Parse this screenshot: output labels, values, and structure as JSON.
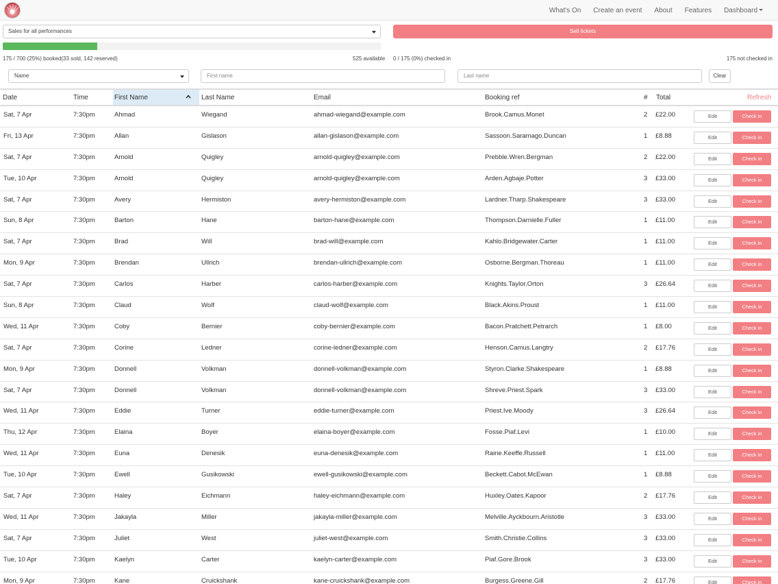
{
  "nav": {
    "links": [
      "What's On",
      "Create an event",
      "About",
      "Features",
      "Dashboard"
    ]
  },
  "performance_select": {
    "value": "Sales for all performances"
  },
  "sell_button": "Sell tickets",
  "progress": {
    "fraction": 0.25
  },
  "stats": {
    "booked": "175 / 700 (25%) booked(33 sold, 142 reserved)",
    "available": "525 available",
    "checked_in": "0 / 175 (0%) checked in",
    "not_checked_in": "175 not checked in"
  },
  "filters": {
    "field_select": "Name",
    "first_name_placeholder": "First name",
    "last_name_placeholder": "Last name",
    "clear": "Clear"
  },
  "table": {
    "headers": {
      "date": "Date",
      "time": "Time",
      "first": "First Name",
      "last": "Last Name",
      "email": "Email",
      "ref": "Booking ref",
      "count": "#",
      "total": "Total"
    },
    "refresh": "Refresh",
    "edit_label": "Edit",
    "checkin_label": "Check in",
    "rows": [
      {
        "date": "Sat, 7 Apr",
        "time": "7:30pm",
        "first": "Ahmad",
        "last": "Wiegand",
        "email": "ahmad-wiegand@example.com",
        "ref": "Brook.Camus.Monet",
        "count": "2",
        "total": "£22.00"
      },
      {
        "date": "Fri, 13 Apr",
        "time": "7:30pm",
        "first": "Allan",
        "last": "Gislason",
        "email": "allan-gislason@example.com",
        "ref": "Sassoon.Saramago.Duncan",
        "count": "1",
        "total": "£8.88"
      },
      {
        "date": "Sat, 7 Apr",
        "time": "7:30pm",
        "first": "Arnold",
        "last": "Quigley",
        "email": "arnold-quigley@example.com",
        "ref": "Prebble.Wren.Bergman",
        "count": "2",
        "total": "£22.00"
      },
      {
        "date": "Tue, 10 Apr",
        "time": "7:30pm",
        "first": "Arnold",
        "last": "Quigley",
        "email": "arnold-quigley@example.com",
        "ref": "Arden.Agbaje.Potter",
        "count": "3",
        "total": "£33.00"
      },
      {
        "date": "Sat, 7 Apr",
        "time": "7:30pm",
        "first": "Avery",
        "last": "Hermiston",
        "email": "avery-hermiston@example.com",
        "ref": "Lardner.Tharp.Shakespeare",
        "count": "3",
        "total": "£33.00"
      },
      {
        "date": "Sun, 8 Apr",
        "time": "7:30pm",
        "first": "Barton",
        "last": "Hane",
        "email": "barton-hane@example.com",
        "ref": "Thompson.Darnielle.Fuller",
        "count": "1",
        "total": "£11.00"
      },
      {
        "date": "Sat, 7 Apr",
        "time": "7:30pm",
        "first": "Brad",
        "last": "Will",
        "email": "brad-will@example.com",
        "ref": "Kahlo.Bridgewater.Carter",
        "count": "1",
        "total": "£11.00"
      },
      {
        "date": "Mon, 9 Apr",
        "time": "7:30pm",
        "first": "Brendan",
        "last": "Ullrich",
        "email": "brendan-ullrich@example.com",
        "ref": "Osborne.Bergman.Thoreau",
        "count": "1",
        "total": "£11.00"
      },
      {
        "date": "Sat, 7 Apr",
        "time": "7:30pm",
        "first": "Carlos",
        "last": "Harber",
        "email": "carlos-harber@example.com",
        "ref": "Knights.Taylor.Orton",
        "count": "3",
        "total": "£26.64"
      },
      {
        "date": "Sun, 8 Apr",
        "time": "7:30pm",
        "first": "Claud",
        "last": "Wolf",
        "email": "claud-wolf@example.com",
        "ref": "Black.Akins.Proust",
        "count": "1",
        "total": "£11.00"
      },
      {
        "date": "Wed, 11 Apr",
        "time": "7:30pm",
        "first": "Coby",
        "last": "Bernier",
        "email": "coby-bernier@example.com",
        "ref": "Bacon.Pratchett.Petrarch",
        "count": "1",
        "total": "£8.00"
      },
      {
        "date": "Sat, 7 Apr",
        "time": "7:30pm",
        "first": "Corine",
        "last": "Ledner",
        "email": "corine-ledner@example.com",
        "ref": "Henson.Camus.Langtry",
        "count": "2",
        "total": "£17.76"
      },
      {
        "date": "Mon, 9 Apr",
        "time": "7:30pm",
        "first": "Donnell",
        "last": "Volkman",
        "email": "donnell-volkman@example.com",
        "ref": "Styron.Clarke.Shakespeare",
        "count": "1",
        "total": "£8.88"
      },
      {
        "date": "Sat, 7 Apr",
        "time": "7:30pm",
        "first": "Donnell",
        "last": "Volkman",
        "email": "donnell-volkman@example.com",
        "ref": "Shreve.Priest.Spark",
        "count": "3",
        "total": "£33.00"
      },
      {
        "date": "Wed, 11 Apr",
        "time": "7:30pm",
        "first": "Eddie",
        "last": "Turner",
        "email": "eddie-turner@example.com",
        "ref": "Priest.Ive.Moody",
        "count": "3",
        "total": "£26.64"
      },
      {
        "date": "Thu, 12 Apr",
        "time": "7:30pm",
        "first": "Elaina",
        "last": "Boyer",
        "email": "elaina-boyer@example.com",
        "ref": "Fosse.Piaf.Levi",
        "count": "1",
        "total": "£10.00"
      },
      {
        "date": "Wed, 11 Apr",
        "time": "7:30pm",
        "first": "Euna",
        "last": "Denesik",
        "email": "euna-denesik@example.com",
        "ref": "Raine.Keeffe.Russell",
        "count": "1",
        "total": "£11.00"
      },
      {
        "date": "Tue, 10 Apr",
        "time": "7:30pm",
        "first": "Ewell",
        "last": "Gusikowski",
        "email": "ewell-gusikowski@example.com",
        "ref": "Beckett.Cabot.McEwan",
        "count": "1",
        "total": "£8.88"
      },
      {
        "date": "Sat, 7 Apr",
        "time": "7:30pm",
        "first": "Haley",
        "last": "Eichmann",
        "email": "haley-eichmann@example.com",
        "ref": "Huxley.Oates.Kapoor",
        "count": "2",
        "total": "£17.76"
      },
      {
        "date": "Wed, 11 Apr",
        "time": "7:30pm",
        "first": "Jakayla",
        "last": "Miller",
        "email": "jakayla-miller@example.com",
        "ref": "Melville.Ayckbourn.Aristotle",
        "count": "3",
        "total": "£33.00"
      },
      {
        "date": "Sat, 7 Apr",
        "time": "7:30pm",
        "first": "Juliet",
        "last": "West",
        "email": "juliet-west@example.com",
        "ref": "Smith.Christie.Collins",
        "count": "3",
        "total": "£33.00"
      },
      {
        "date": "Tue, 10 Apr",
        "time": "7:30pm",
        "first": "Kaelyn",
        "last": "Carter",
        "email": "kaelyn-carter@example.com",
        "ref": "Piaf.Gore.Brook",
        "count": "3",
        "total": "£33.00"
      },
      {
        "date": "Mon, 9 Apr",
        "time": "7:30pm",
        "first": "Kane",
        "last": "Cruickshank",
        "email": "kane-cruickshank@example.com",
        "ref": "Burgess.Greene.Gill",
        "count": "2",
        "total": "£17.76"
      }
    ]
  }
}
